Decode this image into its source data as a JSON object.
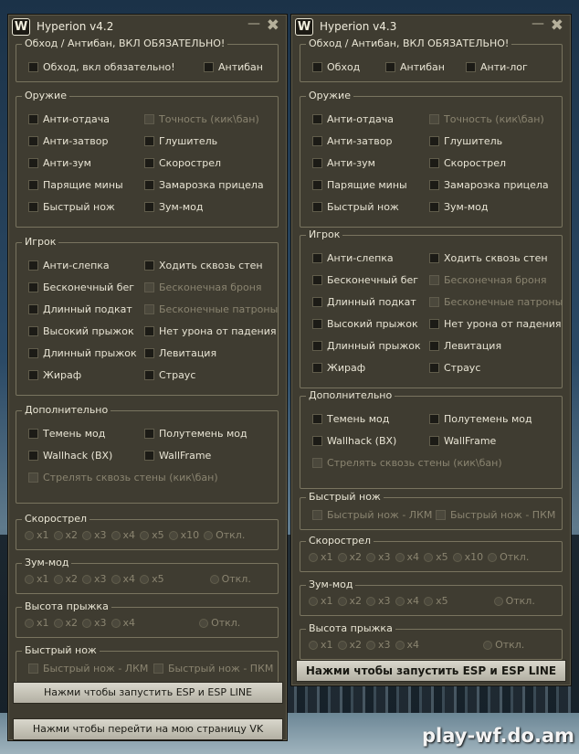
{
  "windows": [
    {
      "title": "Hyperion v4.2",
      "logo": "W",
      "groups": [
        {
          "legend": "Обход / Антибан, ВКЛ ОБЯЗАТЕЛЬНО!",
          "items": [
            "Обход, вкл обязательно!",
            "Антибан"
          ]
        },
        {
          "legend": "Оружие",
          "items": [
            "Анти-отдача",
            "Точность (кик\\бан)",
            "Анти-затвор",
            "Глушитель",
            "Анти-зум",
            "Скорострел",
            "Парящие мины",
            "Замарозка прицела",
            "Быстрый нож",
            "Зум-мод"
          ]
        },
        {
          "legend": "Игрок",
          "items": [
            "Анти-слепка",
            "Ходить сквозь стен",
            "Бесконечный бег",
            "Бесконечная броня",
            "Длинный подкат",
            "Бесконечные патроны",
            "Высокий прыжок",
            "Нет урона от падения",
            "Длинный прыжок",
            "Левитация",
            "Жираф",
            "Страус"
          ]
        },
        {
          "legend": "Дополнительно",
          "items": [
            "Темень мод",
            "Полутемень мод",
            "Wallhack (ВХ)",
            "WallFrame",
            "Стрелять сквозь стены (кик\\бан)"
          ]
        },
        {
          "legend": "Скорострел",
          "radios": [
            "x1",
            "x2",
            "x3",
            "x4",
            "x5",
            "x10",
            "Откл."
          ]
        },
        {
          "legend": "Зум-мод",
          "radios": [
            "x1",
            "x2",
            "x3",
            "x4",
            "x5",
            "Откл."
          ]
        },
        {
          "legend": "Высота прыжка",
          "radios": [
            "x1",
            "x2",
            "x3",
            "x4",
            "Откл."
          ]
        },
        {
          "legend": "Быстрый нож",
          "items": [
            "Быстрый нож - ЛКМ",
            "Быстрый нож - ПКМ"
          ]
        }
      ],
      "buttons": [
        "Нажми чтобы запустить ESP и ESP LINE",
        "Нажми чтобы перейти на мою страницу VK"
      ]
    },
    {
      "title": "Hyperion v4.3",
      "logo": "W",
      "groups": [
        {
          "legend": "Обход / Антибан, ВКЛ ОБЯЗАТЕЛЬНО!",
          "items": [
            "Обход",
            "Антибан",
            "Анти-лог"
          ]
        },
        {
          "legend": "Оружие",
          "items": [
            "Анти-отдача",
            "Точность (кик\\бан)",
            "Анти-затвор",
            "Глушитель",
            "Анти-зум",
            "Скорострел",
            "Парящие мины",
            "Замарозка прицела",
            "Быстрый нож",
            "Зум-мод"
          ]
        },
        {
          "legend": "Игрок",
          "items": [
            "Анти-слепка",
            "Ходить сквозь стен",
            "Бесконечный бег",
            "Бесконечная броня",
            "Длинный подкат",
            "Бесконечные патроны",
            "Высокий прыжок",
            "Нет урона от падения",
            "Длинный прыжок",
            "Левитация",
            "Жираф",
            "Страус"
          ]
        },
        {
          "legend": "Дополнительно",
          "items": [
            "Темень мод",
            "Полутемень мод",
            "Wallhack (ВХ)",
            "WallFrame",
            "Стрелять сквозь стены (кик\\бан)"
          ]
        },
        {
          "legend": "Быстрый нож",
          "items": [
            "Быстрый нож - ЛКМ",
            "Быстрый нож - ПКМ"
          ]
        },
        {
          "legend": "Скорострел",
          "radios": [
            "x1",
            "x2",
            "x3",
            "x4",
            "x5",
            "x10",
            "Откл."
          ]
        },
        {
          "legend": "Зум-мод",
          "radios": [
            "x1",
            "x2",
            "x3",
            "x4",
            "x5",
            "Откл."
          ]
        },
        {
          "legend": "Высота прыжка",
          "radios": [
            "x1",
            "x2",
            "x3",
            "x4",
            "Откл."
          ]
        }
      ],
      "buttons": [
        "Нажми чтобы запустить ESP и ESP LINE"
      ]
    }
  ],
  "watermark": "play-wf.do.am"
}
